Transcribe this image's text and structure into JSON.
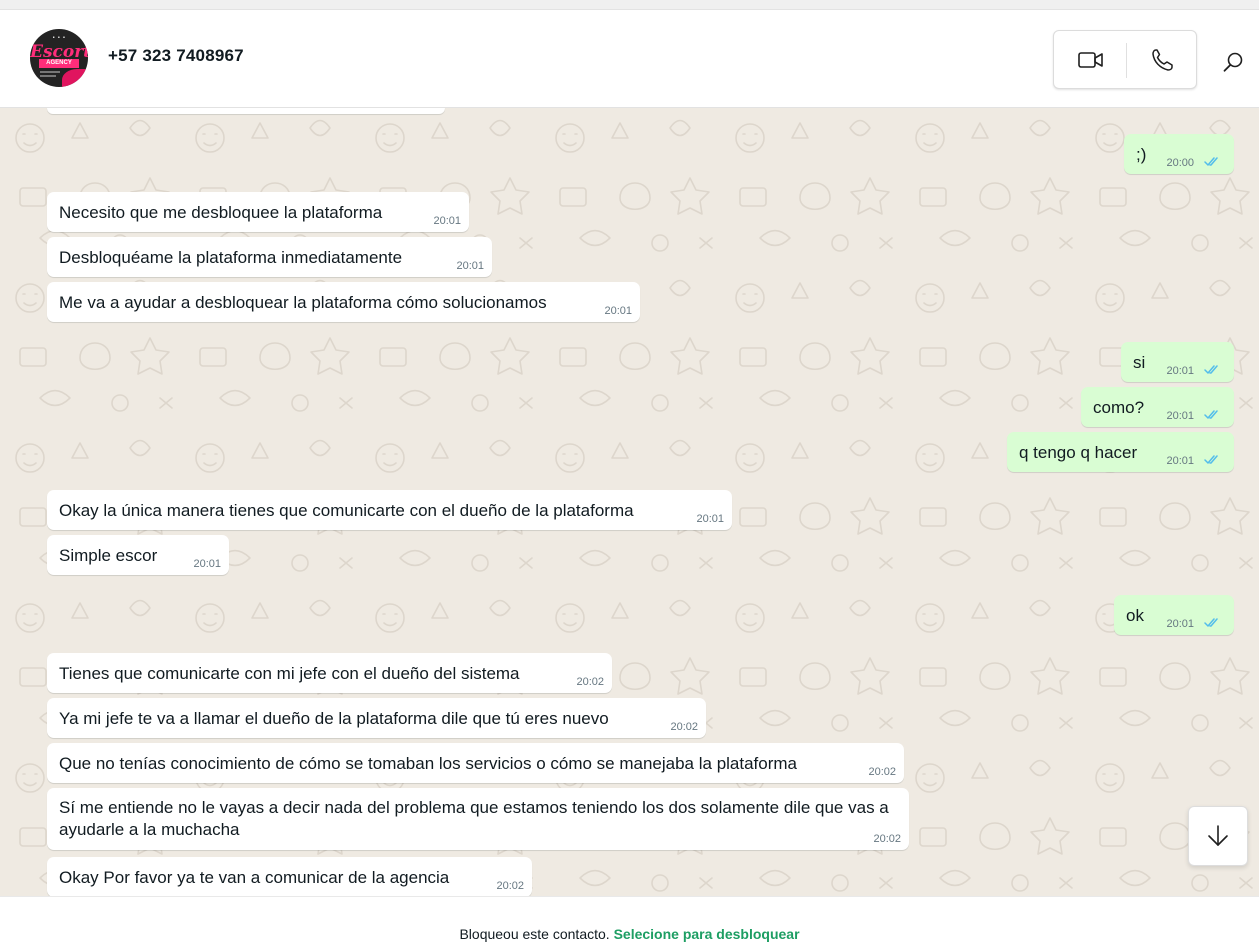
{
  "contact": {
    "name": "+57 323 7408967",
    "avatar_logo": "Escort AGENCY"
  },
  "actions": {
    "video_icon": "video-call-icon",
    "phone_icon": "voice-call-icon",
    "search_icon": "search-icon",
    "scroll_icon": "arrow-down-icon"
  },
  "colors": {
    "chat_background": "#efeae2",
    "incoming_bubble": "#ffffff",
    "outgoing_bubble": "#d9fdd3",
    "read_ticks": "#53bdeb",
    "unblock_link": "#1d9e63"
  },
  "messages": [
    {
      "dir": "out",
      "text": ";)",
      "time": "20:00",
      "read": true
    },
    {
      "dir": "in",
      "text": "Necesito que me desbloquee la plataforma",
      "time": "20:01"
    },
    {
      "dir": "in",
      "text": "Desbloquéame la plataforma inmediatamente",
      "time": "20:01"
    },
    {
      "dir": "in",
      "text": "Me va a ayudar a desbloquear la plataforma cómo solucionamos",
      "time": "20:01"
    },
    {
      "dir": "out",
      "text": "si",
      "time": "20:01",
      "read": true
    },
    {
      "dir": "out",
      "text": "como?",
      "time": "20:01",
      "read": true
    },
    {
      "dir": "out",
      "text": "q tengo q hacer",
      "time": "20:01",
      "read": true
    },
    {
      "dir": "in",
      "text": "Okay la única manera tienes que comunicarte con el dueño de la plataforma",
      "time": "20:01"
    },
    {
      "dir": "in",
      "text": "Simple escor",
      "time": "20:01"
    },
    {
      "dir": "out",
      "text": "ok",
      "time": "20:01",
      "read": true
    },
    {
      "dir": "in",
      "text": "Tienes que comunicarte con mi jefe con el dueño del sistema",
      "time": "20:02"
    },
    {
      "dir": "in",
      "text": "Ya mi jefe te va a llamar el dueño de la plataforma dile que tú eres nuevo",
      "time": "20:02"
    },
    {
      "dir": "in",
      "text": "Que no tenías conocimiento de cómo se tomaban los servicios o cómo se manejaba la plataforma",
      "time": "20:02"
    },
    {
      "dir": "in",
      "text": "Sí me entiende no le vayas a decir nada del problema que estamos teniendo los dos solamente dile que vas a ayudarle a la muchacha",
      "time": "20:02"
    },
    {
      "dir": "in",
      "text": "Okay Por favor ya te van a comunicar de la agencia",
      "time": "20:02"
    }
  ],
  "footer": {
    "blocked_text": "Bloqueou este contacto.",
    "unblock_label": "Selecione para desbloquear"
  }
}
